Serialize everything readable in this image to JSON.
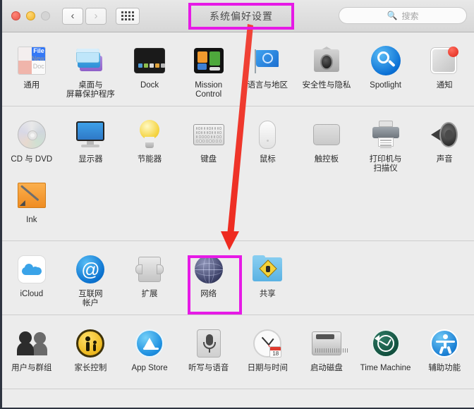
{
  "window": {
    "title": "系统偏好设置",
    "traffic_lights": [
      "close",
      "minimize",
      "zoom-disabled"
    ],
    "nav_back": "‹",
    "nav_forward": "›",
    "grid_button": "show-all-grid"
  },
  "search": {
    "placeholder": "搜索",
    "icon": "search-icon"
  },
  "annotations": {
    "highlight_color": "#e61ae6",
    "arrow_color": "#ee2b20",
    "highlighted_items": [
      "系统偏好设置",
      "网络"
    ]
  },
  "sections": [
    {
      "name": "personal",
      "items": [
        {
          "label": "通用",
          "icon": "general-icon"
        },
        {
          "label": "桌面与\n屏幕保护程序",
          "icon": "desktop-screensaver-icon"
        },
        {
          "label": "Dock",
          "icon": "dock-icon"
        },
        {
          "label": "Mission\nControl",
          "icon": "mission-control-icon"
        },
        {
          "label": "语言与地区",
          "icon": "language-region-icon"
        },
        {
          "label": "安全性与隐私",
          "icon": "security-privacy-icon"
        },
        {
          "label": "Spotlight",
          "icon": "spotlight-icon"
        },
        {
          "label": "通知",
          "icon": "notifications-icon"
        }
      ]
    },
    {
      "name": "hardware",
      "items": [
        {
          "label": "CD 与 DVD",
          "icon": "cd-dvd-icon"
        },
        {
          "label": "显示器",
          "icon": "displays-icon"
        },
        {
          "label": "节能器",
          "icon": "energy-saver-icon"
        },
        {
          "label": "键盘",
          "icon": "keyboard-icon"
        },
        {
          "label": "鼠标",
          "icon": "mouse-icon"
        },
        {
          "label": "触控板",
          "icon": "trackpad-icon"
        },
        {
          "label": "打印机与\n扫描仪",
          "icon": "printers-scanners-icon"
        },
        {
          "label": "声音",
          "icon": "sound-icon"
        },
        {
          "label": "Ink",
          "icon": "ink-icon"
        }
      ]
    },
    {
      "name": "internet-wireless",
      "items": [
        {
          "label": "iCloud",
          "icon": "icloud-icon"
        },
        {
          "label": "互联网\n帐户",
          "icon": "internet-accounts-icon"
        },
        {
          "label": "扩展",
          "icon": "extensions-icon"
        },
        {
          "label": "网络",
          "icon": "network-icon"
        },
        {
          "label": "共享",
          "icon": "sharing-icon"
        }
      ]
    },
    {
      "name": "system",
      "items": [
        {
          "label": "用户与群组",
          "icon": "users-groups-icon"
        },
        {
          "label": "家长控制",
          "icon": "parental-controls-icon"
        },
        {
          "label": "App Store",
          "icon": "app-store-icon"
        },
        {
          "label": "听写与语音",
          "icon": "dictation-speech-icon"
        },
        {
          "label": "日期与时间",
          "icon": "date-time-icon"
        },
        {
          "label": "启动磁盘",
          "icon": "startup-disk-icon"
        },
        {
          "label": "Time Machine",
          "icon": "time-machine-icon"
        },
        {
          "label": "辅助功能",
          "icon": "accessibility-icon"
        }
      ]
    }
  ],
  "calendar_day": "18"
}
